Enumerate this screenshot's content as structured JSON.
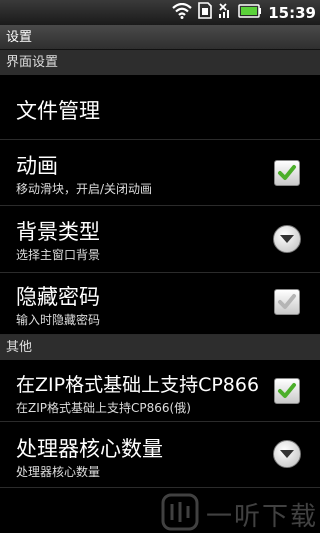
{
  "status_bar": {
    "time": "15:39"
  },
  "title": "设置",
  "sections": {
    "interface": "界面设置",
    "other": "其他"
  },
  "items": [
    {
      "title": "文件管理",
      "subtitle": "",
      "control": "none"
    },
    {
      "title": "动画",
      "subtitle": "移动滑块，开启/关闭动画",
      "control": "checkbox",
      "checked": true
    },
    {
      "title": "背景类型",
      "subtitle": "选择主窗口背景",
      "control": "dropdown"
    },
    {
      "title": "隐藏密码",
      "subtitle": "输入时隐藏密码",
      "control": "checkbox",
      "checked": false
    },
    {
      "title": "在ZIP格式基础上支持CP866",
      "subtitle": "在ZIP格式基础上支持CP866(俄)",
      "control": "checkbox",
      "checked": true
    },
    {
      "title": "处理器核心数量",
      "subtitle": "处理器核心数量",
      "control": "dropdown"
    }
  ],
  "watermark": {
    "text": "一听下载"
  },
  "colors": {
    "check": "#4caf2a",
    "check_disabled": "#b5b5b5"
  }
}
